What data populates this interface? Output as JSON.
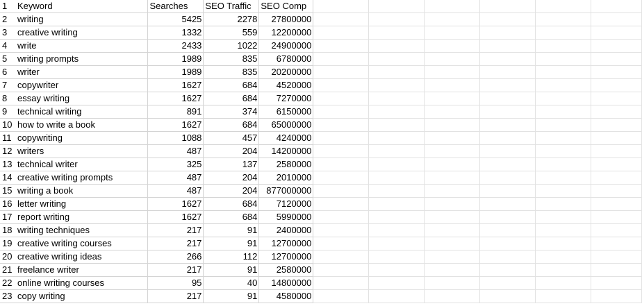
{
  "spreadsheet": {
    "headers": [
      "Keyword",
      "Searches",
      "SEO Traffic",
      "SEO Comp"
    ],
    "rows": [
      {
        "num": "1",
        "cells": [
          "Keyword",
          "Searches",
          "SEO Traffic",
          "SEO Comp"
        ]
      },
      {
        "num": "2",
        "cells": [
          "writing",
          "5425",
          "2278",
          "27800000"
        ]
      },
      {
        "num": "3",
        "cells": [
          "creative writing",
          "1332",
          "559",
          "12200000"
        ]
      },
      {
        "num": "4",
        "cells": [
          "write",
          "2433",
          "1022",
          "24900000"
        ]
      },
      {
        "num": "5",
        "cells": [
          "writing prompts",
          "1989",
          "835",
          "6780000"
        ]
      },
      {
        "num": "6",
        "cells": [
          "writer",
          "1989",
          "835",
          "20200000"
        ]
      },
      {
        "num": "7",
        "cells": [
          "copywriter",
          "1627",
          "684",
          "4520000"
        ]
      },
      {
        "num": "8",
        "cells": [
          "essay writing",
          "1627",
          "684",
          "7270000"
        ]
      },
      {
        "num": "9",
        "cells": [
          "technical writing",
          "891",
          "374",
          "6150000"
        ]
      },
      {
        "num": "10",
        "cells": [
          "how to write a book",
          "1627",
          "684",
          "65000000"
        ]
      },
      {
        "num": "11",
        "cells": [
          "copywriting",
          "1088",
          "457",
          "4240000"
        ]
      },
      {
        "num": "12",
        "cells": [
          "writers",
          "487",
          "204",
          "14200000"
        ]
      },
      {
        "num": "13",
        "cells": [
          "technical writer",
          "325",
          "137",
          "2580000"
        ]
      },
      {
        "num": "14",
        "cells": [
          "creative writing prompts",
          "487",
          "204",
          "2010000"
        ]
      },
      {
        "num": "15",
        "cells": [
          "writing a book",
          "487",
          "204",
          "877000000"
        ]
      },
      {
        "num": "16",
        "cells": [
          "letter writing",
          "1627",
          "684",
          "7120000"
        ]
      },
      {
        "num": "17",
        "cells": [
          "report writing",
          "1627",
          "684",
          "5990000"
        ]
      },
      {
        "num": "18",
        "cells": [
          "writing techniques",
          "217",
          "91",
          "2400000"
        ]
      },
      {
        "num": "19",
        "cells": [
          "creative writing courses",
          "217",
          "91",
          "12700000"
        ]
      },
      {
        "num": "20",
        "cells": [
          "creative writing ideas",
          "266",
          "112",
          "12700000"
        ]
      },
      {
        "num": "21",
        "cells": [
          "freelance writer",
          "217",
          "91",
          "2580000"
        ]
      },
      {
        "num": "22",
        "cells": [
          "online writing courses",
          "95",
          "40",
          "14800000"
        ]
      },
      {
        "num": "23",
        "cells": [
          "copy writing",
          "217",
          "91",
          "4580000"
        ]
      }
    ]
  }
}
